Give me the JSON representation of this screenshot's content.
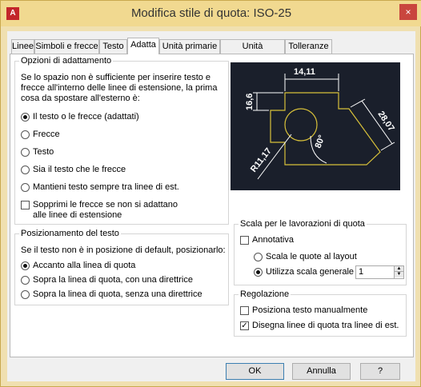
{
  "window": {
    "title": "Modifica stile di quota: ISO-25",
    "app_icon_letter": "A",
    "close_glyph": "×"
  },
  "tabs": [
    {
      "label": "Linee"
    },
    {
      "label": "Simboli e frecce"
    },
    {
      "label": "Testo"
    },
    {
      "label": "Adatta",
      "active": true
    },
    {
      "label": "Unità primarie"
    },
    {
      "label": "Unità alternative"
    },
    {
      "label": "Tolleranze"
    }
  ],
  "fit_options": {
    "title": "Opzioni di adattamento",
    "intro": [
      "Se lo spazio non è sufficiente per inserire testo e",
      "frecce all'interno delle linee di estensione, la prima",
      "cosa da spostare all'esterno è:"
    ],
    "options": [
      {
        "label": "Il testo o le frecce (adattati)",
        "checked": true
      },
      {
        "label": "Frecce",
        "checked": false
      },
      {
        "label": "Testo",
        "checked": false
      },
      {
        "label": "Sia il testo che le frecce",
        "checked": false
      },
      {
        "label": "Mantieni testo sempre tra linee di est.",
        "checked": false
      }
    ],
    "suppress_label_1": "Sopprimi le frecce se non si adattano",
    "suppress_label_2": "alle linee di estensione"
  },
  "text_placement": {
    "title": "Posizionamento del testo",
    "intro": "Se il testo non è in posizione di default, posizionarlo:",
    "options": [
      {
        "label": "Accanto alla linea di quota",
        "checked": true
      },
      {
        "label": "Sopra la linea di quota, con una direttrice",
        "checked": false
      },
      {
        "label": "Sopra la linea di quota, senza una direttrice",
        "checked": false
      }
    ]
  },
  "preview": {
    "dim_top": "14,11",
    "dim_left": "16,6",
    "dim_right": "28,07",
    "dim_angle": "80°",
    "dim_radius": "R11,17",
    "colors": {
      "bg": "#1a1f2b",
      "line": "#ffffff",
      "shape": "#d8c13a"
    }
  },
  "scale": {
    "title": "Scala per le lavorazioni di quota",
    "annotative_label": "Annotativa",
    "annotative_checked": false,
    "layout_label": "Scala le quote al layout",
    "overall_label": "Utilizza scala generale di:",
    "overall_value": "1"
  },
  "fine_tuning": {
    "title": "Regolazione",
    "manual_label": "Posiziona testo manualmente",
    "manual_checked": false,
    "draw_label": "Disegna linee di quota tra linee di est.",
    "draw_checked": true
  },
  "buttons": {
    "ok": "OK",
    "cancel": "Annulla",
    "help": "?"
  }
}
